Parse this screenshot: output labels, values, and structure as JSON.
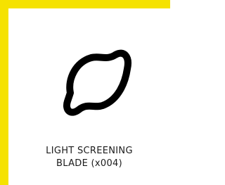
{
  "card": {
    "accent_color": "#f5e200",
    "icon": "light-screening-blade-icon",
    "label_line1": "LIGHT SCREENING",
    "label_line2": "BLADE (x004)"
  }
}
